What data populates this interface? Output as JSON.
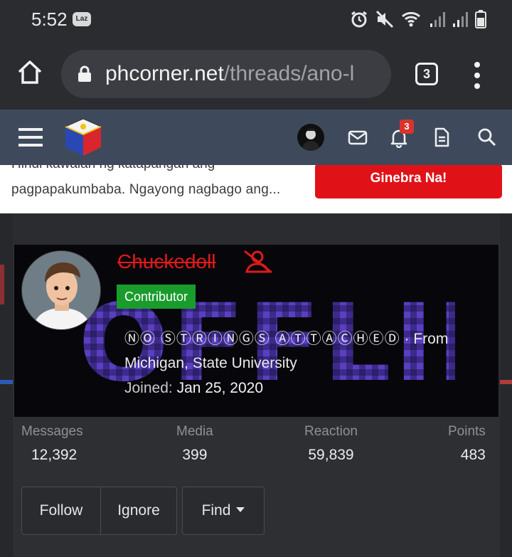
{
  "status_bar": {
    "time": "5:52",
    "app_badge": "Laz"
  },
  "browser": {
    "url_host": "phcorner.net",
    "url_path": "/threads/ano-l",
    "tab_count": "3"
  },
  "site_header": {
    "notification_count": "3"
  },
  "banner": {
    "line1": "Hindi kawalan ng katapangan ang",
    "line2": "pagpapakumbaba. Ngayong nagbago ang...",
    "cta_label": "Ginebra Na!"
  },
  "profile": {
    "username": "Chuckedoll",
    "role": "Contributor",
    "tagline": "ⓃⓄ ⓈⓉⓇⒾⓃⒼⓈ ⒶⓉⓉⒶⒸⒽⒺⒹ",
    "from_text": "· From",
    "location": "Michigan, State University",
    "joined_label": "Joined:",
    "joined_date": "Jan 25, 2020",
    "cover_text": "OFFLINE"
  },
  "stats": [
    {
      "label": "Messages",
      "value": "12,392"
    },
    {
      "label": "Media",
      "value": "399"
    },
    {
      "label": "Reaction",
      "value": "59,839"
    },
    {
      "label": "Points",
      "value": "483"
    }
  ],
  "actions": {
    "follow": "Follow",
    "ignore": "Ignore",
    "find": "Find"
  },
  "colors": {
    "header_bg": "#3e4a5c",
    "username_red": "#e01a1a",
    "role_green": "#1a9c2d",
    "cta_red": "#e01218"
  }
}
